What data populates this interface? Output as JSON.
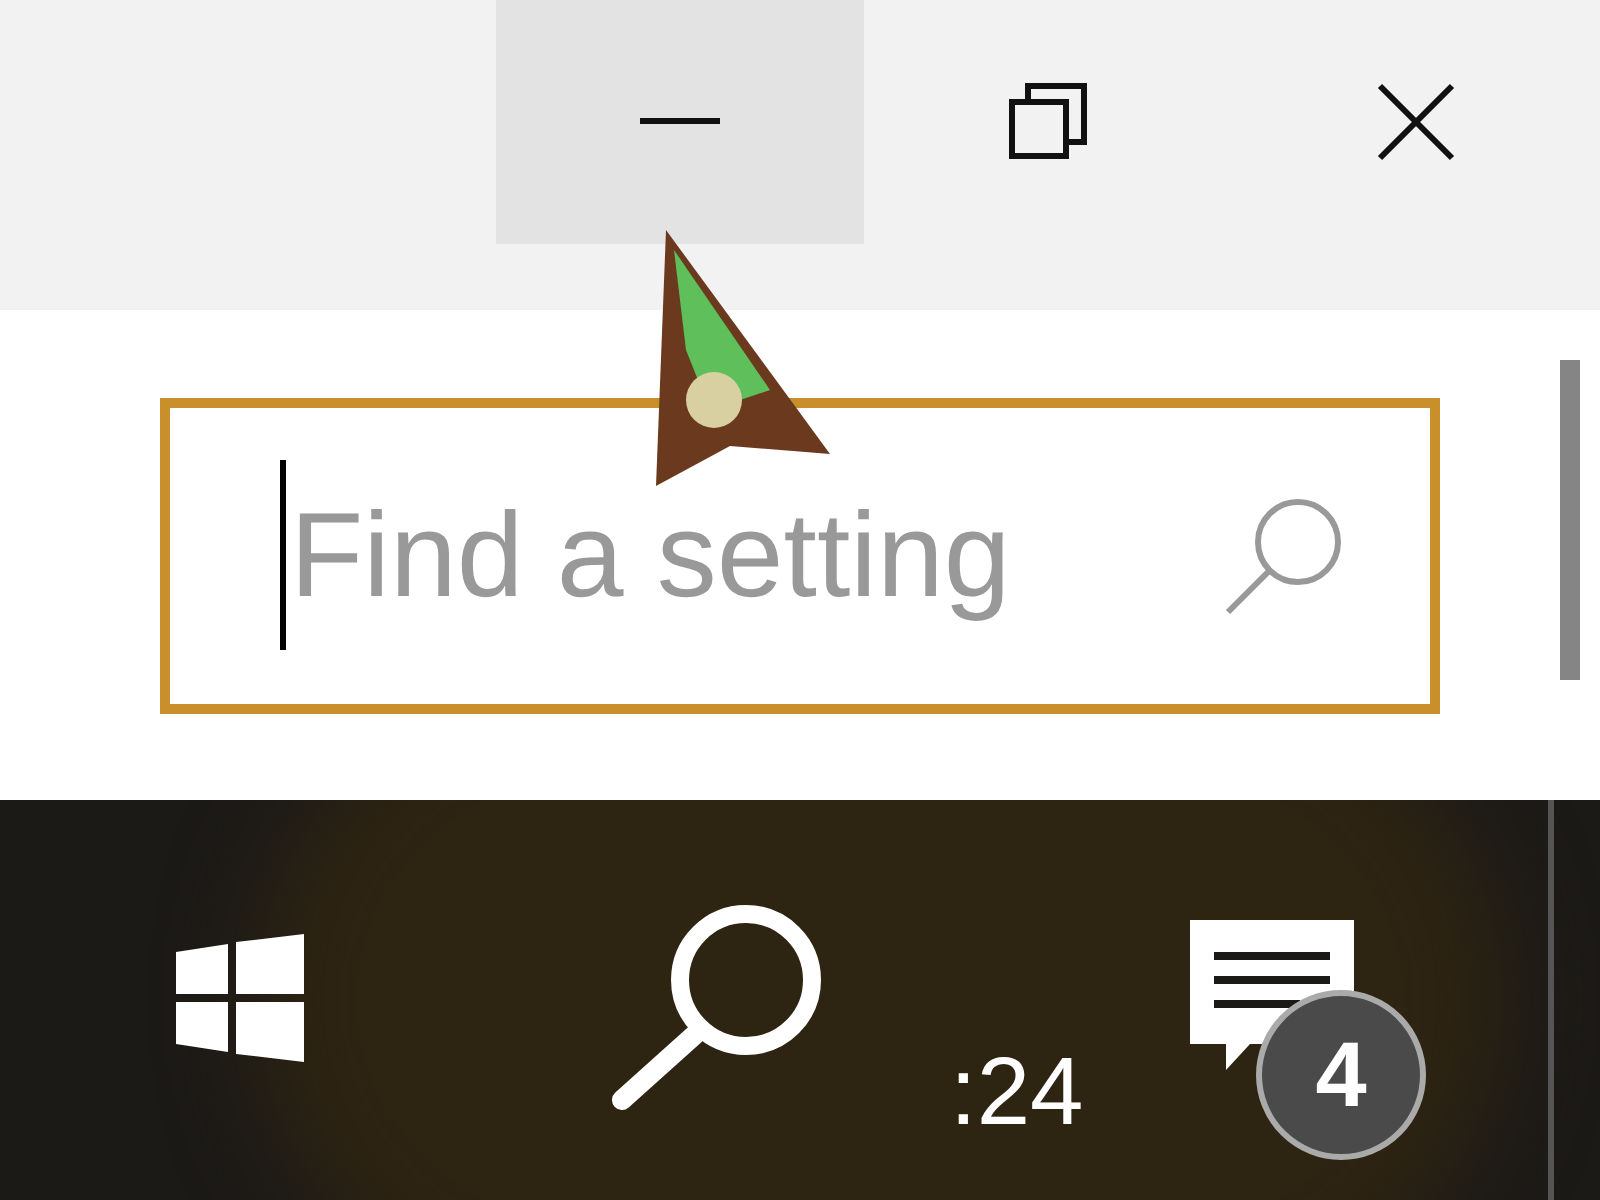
{
  "title_bar": {
    "buttons": [
      {
        "kind": "minimize",
        "hovered": true
      },
      {
        "kind": "restore",
        "hovered": false
      },
      {
        "kind": "close",
        "hovered": false
      }
    ]
  },
  "search": {
    "placeholder": "Find a setting",
    "focused": true
  },
  "taskbar": {
    "clock": ":24",
    "notification_count": "4"
  }
}
